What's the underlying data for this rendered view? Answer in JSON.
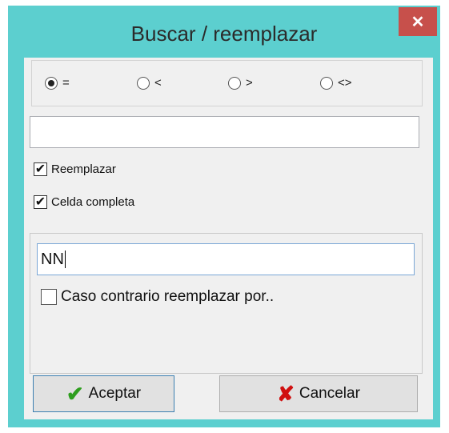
{
  "window": {
    "title": "Buscar / reemplazar",
    "close_label": "✕"
  },
  "operators": [
    {
      "label": "=",
      "checked": true
    },
    {
      "label": "<",
      "checked": false
    },
    {
      "label": ">",
      "checked": false
    },
    {
      "label": "<>",
      "checked": false
    }
  ],
  "search_field": {
    "value": ""
  },
  "options": {
    "reemplazar": {
      "label": "Reemplazar",
      "checked": true
    },
    "celda_completa": {
      "label": "Celda completa",
      "checked": true
    }
  },
  "replace_field": {
    "value": "NN"
  },
  "otherwise": {
    "label": "Caso contrario reemplazar por..",
    "checked": false
  },
  "buttons": {
    "accept_label": "Aceptar",
    "cancel_label": "Cancelar"
  },
  "colors": {
    "title_bar": "#5ccfcf",
    "close_button": "#c7504b",
    "accept_icon": "#2e9e1e",
    "cancel_icon": "#d01010"
  }
}
